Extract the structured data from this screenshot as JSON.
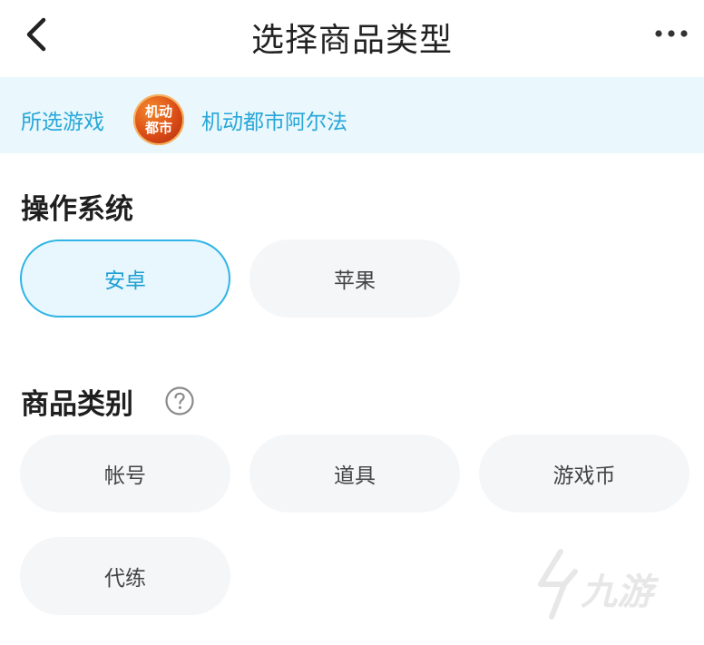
{
  "header": {
    "title": "选择商品类型"
  },
  "game_bar": {
    "label": "所选游戏",
    "logo_text": [
      "机动",
      "都市"
    ],
    "game_name": "机动都市阿尔法"
  },
  "os_section": {
    "title": "操作系统",
    "options": [
      {
        "label": "安卓",
        "selected": true
      },
      {
        "label": "苹果",
        "selected": false
      }
    ]
  },
  "category_section": {
    "title": "商品类别",
    "options": [
      {
        "label": "帐号",
        "selected": false
      },
      {
        "label": "道具",
        "selected": false
      },
      {
        "label": "游戏币",
        "selected": false
      },
      {
        "label": "代练",
        "selected": false
      }
    ]
  },
  "watermark": {
    "text": "九游"
  },
  "colors": {
    "accent": "#2fb4e6",
    "accent_text": "#27a7d8",
    "game_bar_bg": "#eaf7fc",
    "chip_bg": "#f5f6f8"
  }
}
